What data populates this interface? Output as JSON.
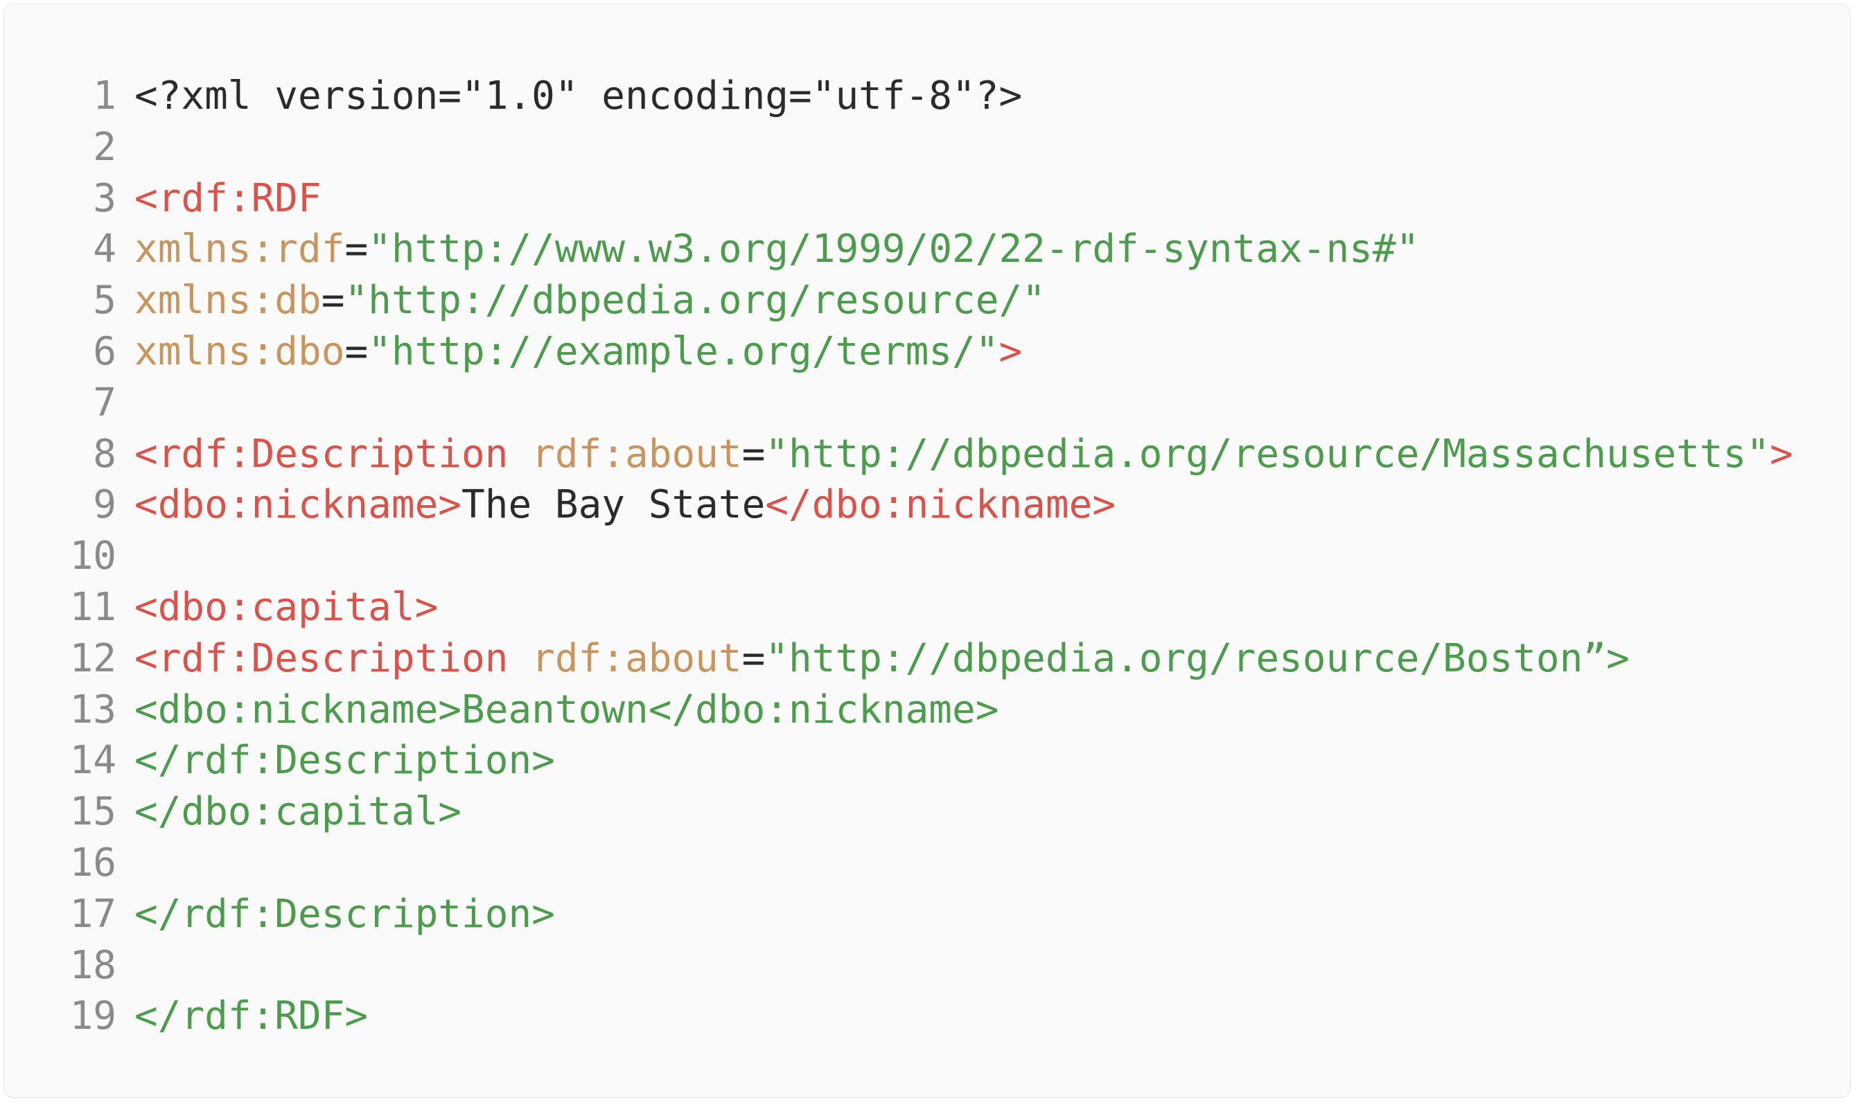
{
  "colors": {
    "background": "#fafafa",
    "line_number": "#8a8a8a",
    "plain": "#2b2b2b",
    "tag": "#d9534a",
    "attribute": "#c8955e",
    "string": "#4d9c4e"
  },
  "lines": [
    {
      "n": "1",
      "tokens": [
        {
          "t": "<?xml version=\"1.0\" encoding=\"utf-8\"?>",
          "c": "plain"
        }
      ]
    },
    {
      "n": "2",
      "tokens": []
    },
    {
      "n": "3",
      "tokens": [
        {
          "t": "<rdf:RDF",
          "c": "tag"
        }
      ]
    },
    {
      "n": "4",
      "tokens": [
        {
          "t": "xmlns:rdf",
          "c": "attr"
        },
        {
          "t": "=",
          "c": "punct"
        },
        {
          "t": "\"http://www.w3.org/1999/02/22-rdf-syntax-ns#\"",
          "c": "str"
        }
      ]
    },
    {
      "n": "5",
      "tokens": [
        {
          "t": "xmlns:db",
          "c": "attr"
        },
        {
          "t": "=",
          "c": "punct"
        },
        {
          "t": "\"http://dbpedia.org/resource/\"",
          "c": "str"
        }
      ]
    },
    {
      "n": "6",
      "tokens": [
        {
          "t": "xmlns:dbo",
          "c": "attr"
        },
        {
          "t": "=",
          "c": "punct"
        },
        {
          "t": "\"http://example.org/terms/\"",
          "c": "str"
        },
        {
          "t": ">",
          "c": "tag"
        }
      ]
    },
    {
      "n": "7",
      "tokens": []
    },
    {
      "n": "8",
      "tokens": [
        {
          "t": "<rdf:Description",
          "c": "tag"
        },
        {
          "t": " ",
          "c": "plain"
        },
        {
          "t": "rdf:about",
          "c": "attr"
        },
        {
          "t": "=",
          "c": "punct"
        },
        {
          "t": "\"http://dbpedia.org/resource/Massachusetts\"",
          "c": "str"
        },
        {
          "t": ">",
          "c": "tag"
        }
      ]
    },
    {
      "n": "9",
      "tokens": [
        {
          "t": "<dbo:nickname>",
          "c": "tag"
        },
        {
          "t": "The Bay State",
          "c": "text"
        },
        {
          "t": "</dbo:nickname>",
          "c": "tag"
        }
      ]
    },
    {
      "n": "10",
      "tokens": []
    },
    {
      "n": "11",
      "tokens": [
        {
          "t": "<dbo:capital>",
          "c": "tag"
        }
      ]
    },
    {
      "n": "12",
      "tokens": [
        {
          "t": "<rdf:Description",
          "c": "tag"
        },
        {
          "t": " ",
          "c": "plain"
        },
        {
          "t": "rdf:about",
          "c": "attr"
        },
        {
          "t": "=",
          "c": "punct"
        },
        {
          "t": "\"http://dbpedia.org/resource/Boston”>",
          "c": "str"
        }
      ]
    },
    {
      "n": "13",
      "tokens": [
        {
          "t": "<dbo:nickname>Beantown</dbo:nickname>",
          "c": "str"
        }
      ]
    },
    {
      "n": "14",
      "tokens": [
        {
          "t": "</rdf:Description>",
          "c": "str"
        }
      ]
    },
    {
      "n": "15",
      "tokens": [
        {
          "t": "</dbo:capital>",
          "c": "str"
        }
      ]
    },
    {
      "n": "16",
      "tokens": []
    },
    {
      "n": "17",
      "tokens": [
        {
          "t": "</rdf:Description>",
          "c": "str"
        }
      ]
    },
    {
      "n": "18",
      "tokens": []
    },
    {
      "n": "19",
      "tokens": [
        {
          "t": "</rdf:RDF>",
          "c": "str"
        }
      ]
    }
  ]
}
